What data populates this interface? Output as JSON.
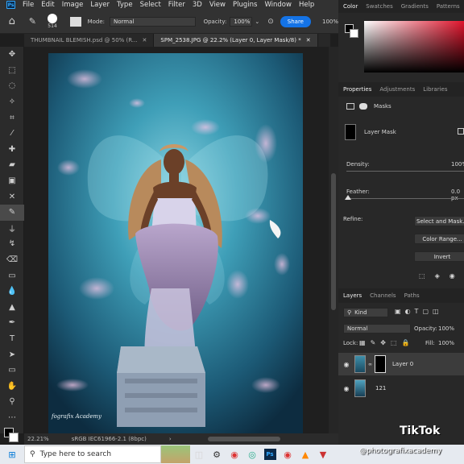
{
  "menu": [
    "File",
    "Edit",
    "Image",
    "Layer",
    "Type",
    "Select",
    "Filter",
    "3D",
    "View",
    "Plugins",
    "Window",
    "Help"
  ],
  "options": {
    "brush_size": "514",
    "mode_label": "Mode:",
    "mode_value": "Normal",
    "opacity_label": "Opacity:",
    "opacity_value": "100%",
    "share_label": "Share",
    "flow_value": "100%"
  },
  "doc_tabs": [
    {
      "label": "THUMBNAIL BLEMISH.psd @ 50% (R..."
    },
    {
      "label": "SPM_2538.JPG @ 22.2% (Layer 0, Layer Mask/8) *"
    }
  ],
  "canvas": {
    "watermark": "fografix Academy"
  },
  "status": {
    "zoom": "22.21%",
    "profile": "sRGB IEC61966-2.1 (8bpc)"
  },
  "color_panel": {
    "tabs": [
      "Color",
      "Swatches",
      "Gradients",
      "Patterns"
    ]
  },
  "properties": {
    "tabs": [
      "Properties",
      "Adjustments",
      "Libraries"
    ],
    "masks_label": "Masks",
    "layer_mask_label": "Layer Mask",
    "density_label": "Density:",
    "density_value": "100%",
    "feather_label": "Feather:",
    "feather_value": "0.0 px",
    "refine_label": "Refine:",
    "select_mask_btn": "Select and Mask...",
    "color_range_btn": "Color Range...",
    "invert_btn": "Invert"
  },
  "layers_panel": {
    "tabs": [
      "Layers",
      "Channels",
      "Paths"
    ],
    "kind_label": "Kind",
    "blend_mode": "Normal",
    "opacity_label": "Opacity:",
    "opacity_value": "100%",
    "lock_label": "Lock:",
    "fill_label": "Fill:",
    "fill_value": "100%",
    "layers": [
      {
        "name": "Layer 0"
      },
      {
        "name": "121"
      }
    ]
  },
  "taskbar": {
    "search_placeholder": "Type here to search"
  },
  "overlay": {
    "tiktok": "TikTok",
    "handle": "@photografixacademy"
  }
}
